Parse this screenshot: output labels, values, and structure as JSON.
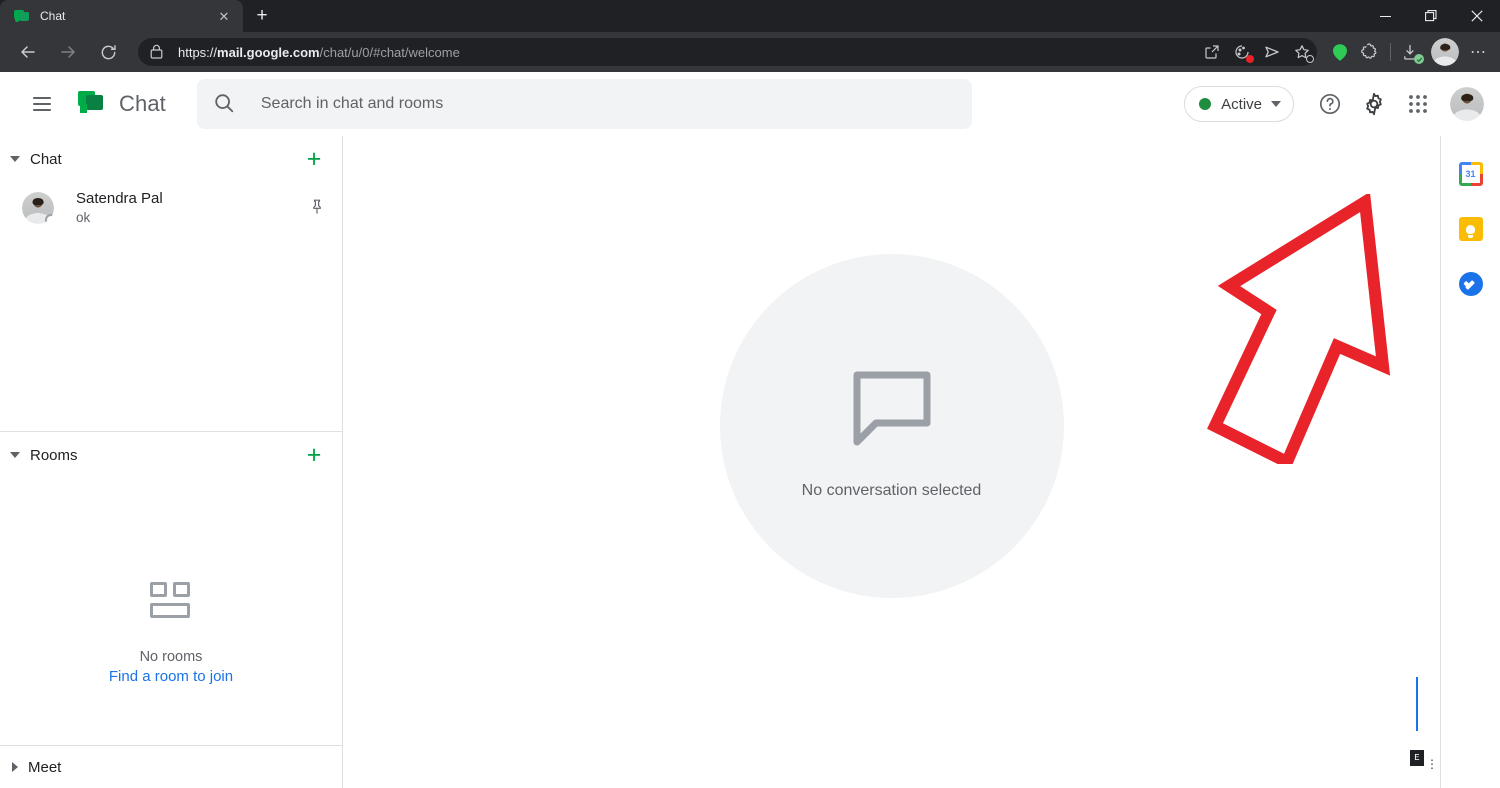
{
  "browser": {
    "tab": {
      "title": "Chat",
      "favicon": "chat-bubble-icon",
      "close": "✕"
    },
    "new_tab": "+",
    "window": {
      "minimize": "minimize-icon",
      "maximize": "maximize-icon",
      "close": "close-icon"
    },
    "nav": {
      "back": "back-arrow-icon",
      "forward": "forward-arrow-icon",
      "reload": "reload-icon"
    },
    "omnibox": {
      "lock": "lock-icon",
      "scheme": "https://",
      "domain": "mail.google.com",
      "path": "/chat/u/0/#chat/welcome",
      "full_url": "https://mail.google.com/chat/u/0/#chat/welcome",
      "share_icon": "share-icon",
      "cookie_icon": "cookie-blocked-icon",
      "send_icon": "send-to-device-icon",
      "bookmark_icon": "bookmark-star-icon"
    },
    "extensions": [
      {
        "name": "green-extension-icon",
        "color": "#2ecc56"
      },
      {
        "name": "puzzle-extension-icon",
        "color": "#c8cace"
      }
    ],
    "downloads_icon": "download-complete-icon",
    "profile_avatar": "user-avatar",
    "menu": "⋯"
  },
  "app": {
    "hamburger": "main-menu-icon",
    "logo": "google-chat-logo",
    "name": "Chat",
    "search": {
      "icon": "search-icon",
      "placeholder": "Search in chat and rooms",
      "value": ""
    },
    "status": {
      "label": "Active",
      "dot_color": "#1e8e3e",
      "chevron": "chevron-down-icon"
    },
    "help_icon": "help-circle-icon",
    "settings_icon": "gear-icon",
    "apps_icon": "apps-grid-icon",
    "account_avatar": "account-avatar"
  },
  "sidebar": {
    "chat_section": {
      "title": "Chat",
      "expanded": true,
      "add_label": "+",
      "conversations": [
        {
          "name": "Satendra Pal",
          "preview": "ok",
          "pin_icon": "pin-icon",
          "presence": "away"
        }
      ]
    },
    "rooms_section": {
      "title": "Rooms",
      "expanded": true,
      "add_label": "+",
      "empty_icon": "rooms-icon",
      "empty_title": "No rooms",
      "empty_link": "Find a room to join"
    },
    "meet_section": {
      "title": "Meet",
      "expanded": false
    }
  },
  "main": {
    "empty_icon": "speech-bubble-icon",
    "empty_text": "No conversation selected",
    "mini_badge": "E",
    "kebab": "⋮"
  },
  "right_rail": {
    "items": [
      {
        "name": "google-calendar-icon",
        "label": "31"
      },
      {
        "name": "google-keep-icon",
        "label": ""
      },
      {
        "name": "google-tasks-icon",
        "label": ""
      }
    ]
  },
  "annotation": {
    "type": "arrow-up-right",
    "color": "#e8232a",
    "points_to": "gear-icon"
  }
}
